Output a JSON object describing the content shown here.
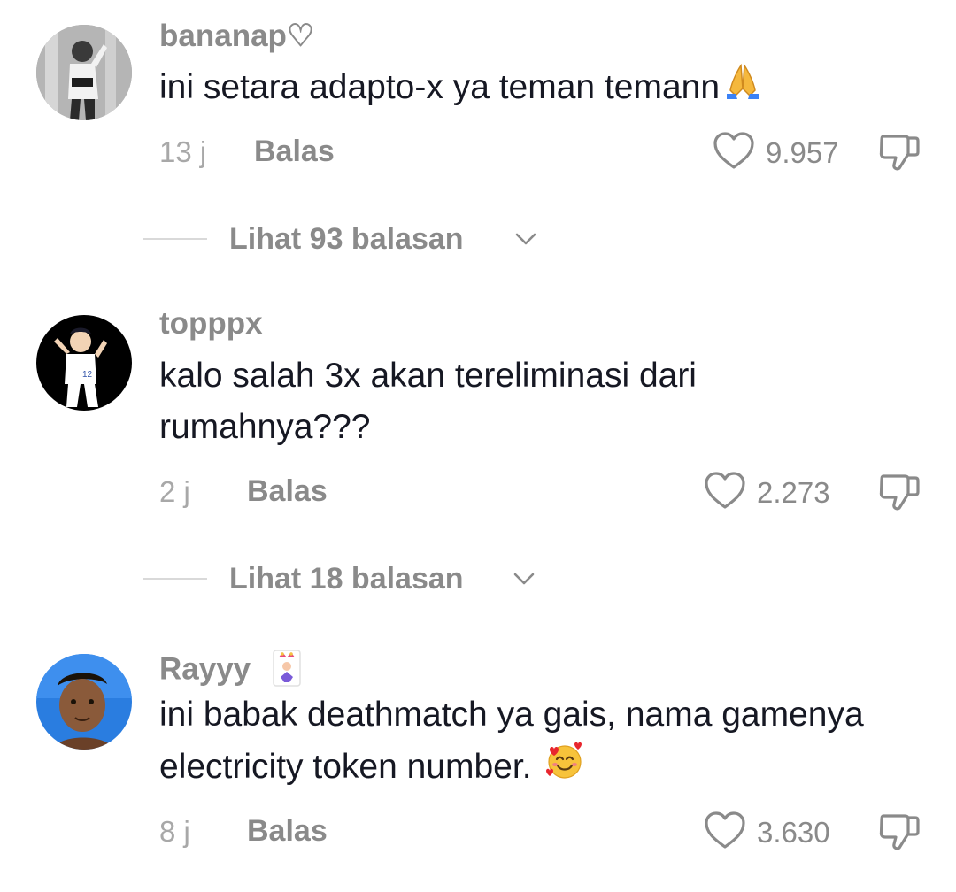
{
  "comments": [
    {
      "username": "bananap♡",
      "text_lines": [
        "ini setara adapto-x ya teman temann"
      ],
      "emoji": "folded-hands",
      "time": "13 j",
      "reply_label": "Balas",
      "likes": "9.957",
      "view_replies": "Lihat 93 balasan"
    },
    {
      "username": "topppx",
      "text_lines": [
        "kalo salah 3x akan tereliminasi dari",
        "rumahnya???"
      ],
      "emoji": "",
      "time": "2 j",
      "reply_label": "Balas",
      "likes": "2.273",
      "view_replies": "Lihat 18 balasan"
    },
    {
      "username": "Rayyy",
      "badge": "joker-card-icon",
      "text_lines": [
        "ini babak deathmatch ya gais, nama gamenya",
        "electricity token number."
      ],
      "emoji": "smiling-face-with-hearts",
      "time": "8 j",
      "reply_label": "Balas",
      "likes": "3.630"
    }
  ],
  "colors": {
    "text": "#161823",
    "muted": "#8a8a8a",
    "time": "#a8a8a8",
    "divider": "#d9d9d9"
  }
}
